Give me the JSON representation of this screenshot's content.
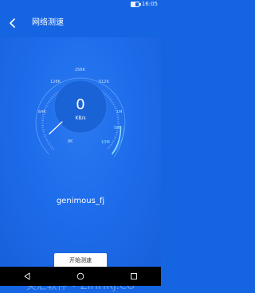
{
  "status_bar": {
    "time": "16:05",
    "battery_level": 0.6,
    "battery_icon": "battery-icon"
  },
  "header": {
    "title": "网络测速",
    "back_icon": "back-arrow-icon"
  },
  "gauge": {
    "value": "0",
    "unit": "KB/s",
    "needle_icon": "gauge-needle-icon",
    "ticks": [
      "8K",
      "64K",
      "128K",
      "256K",
      "512K",
      "1M",
      "5M",
      "10M"
    ],
    "colors": {
      "active_arc": "#8fe0ff",
      "track": "#5fa2f7",
      "center": "#1a63d6"
    }
  },
  "network": {
    "ssid": "genimous_fj"
  },
  "actions": {
    "start_label": "开始测速"
  },
  "watermark": {
    "text": "尖汇软件 • ZIHHRJ.CO"
  },
  "nav_bar": {
    "icons": [
      "nav-back-icon",
      "nav-home-icon",
      "nav-recent-icon"
    ]
  },
  "theme": {
    "primary": "#1565e3"
  }
}
